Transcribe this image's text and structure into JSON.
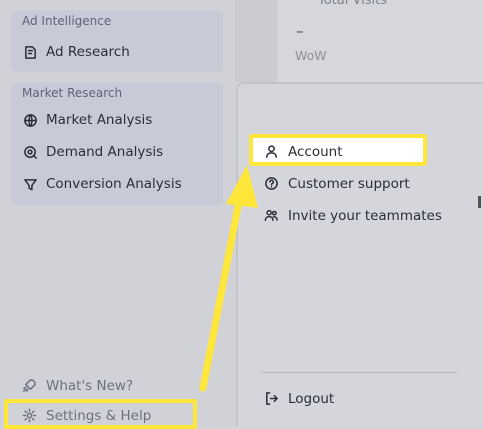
{
  "sidebar": {
    "groups": [
      {
        "title": "Ad Intelligence",
        "items": [
          {
            "label": "Ad Research",
            "icon": "ad-research-icon"
          }
        ]
      },
      {
        "title": "Market Research",
        "items": [
          {
            "label": "Market Analysis",
            "icon": "globe-icon"
          },
          {
            "label": "Demand Analysis",
            "icon": "search-analysis-icon"
          },
          {
            "label": "Conversion Analysis",
            "icon": "funnel-icon"
          }
        ]
      }
    ],
    "bottom": [
      {
        "label": "What's New?",
        "icon": "rocket-icon"
      },
      {
        "label": "Settings & Help",
        "icon": "gear-icon"
      }
    ]
  },
  "stat": {
    "label": "Total Visits",
    "value": "–",
    "sub": "WoW"
  },
  "menu": {
    "items": [
      {
        "label": "Account",
        "icon": "user-icon"
      },
      {
        "label": "Customer support",
        "icon": "help-circle-icon"
      },
      {
        "label": "Invite your teammates",
        "icon": "users-icon"
      }
    ],
    "logout": {
      "label": "Logout",
      "icon": "logout-icon"
    }
  },
  "colors": {
    "highlight": "#ffe63a",
    "arrow": "#ffe63a"
  }
}
